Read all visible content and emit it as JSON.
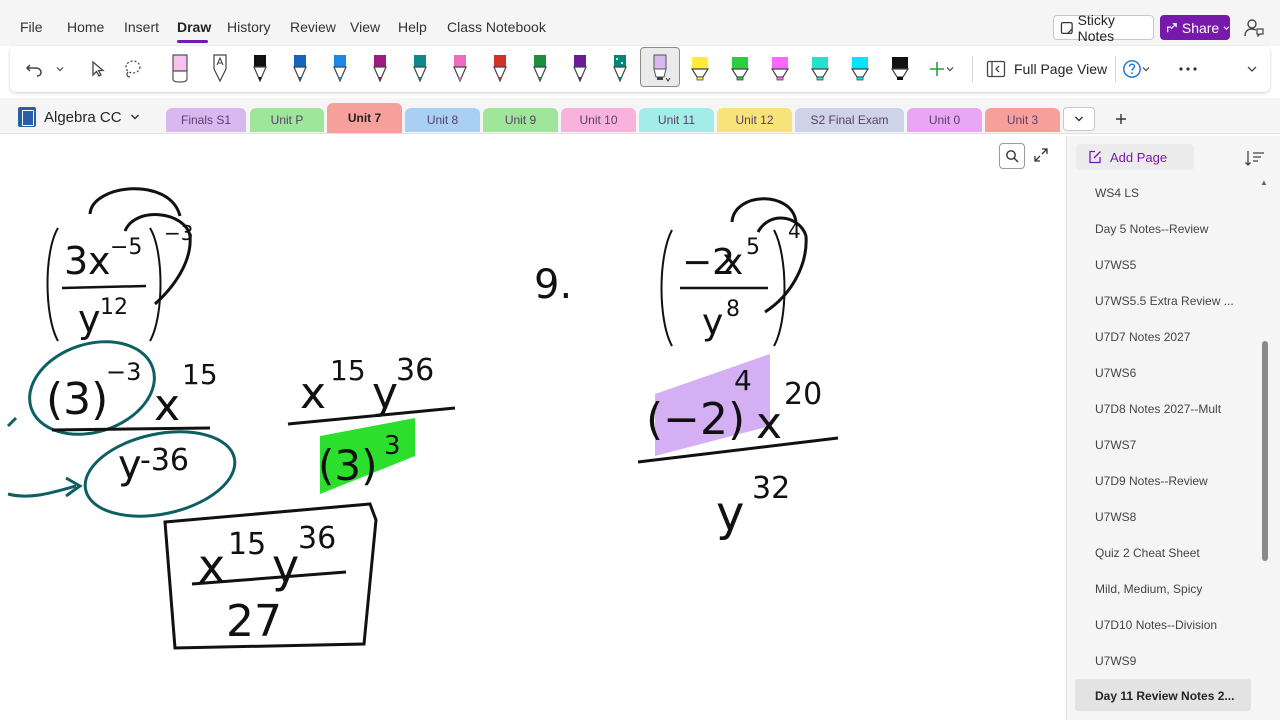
{
  "menu": {
    "items": [
      "File",
      "Home",
      "Insert",
      "Draw",
      "History",
      "Review",
      "View",
      "Help",
      "Class Notebook"
    ],
    "active": "Draw",
    "sticky_notes": "Sticky Notes",
    "share": "Share"
  },
  "ribbon": {
    "full_page_view": "Full Page View",
    "pen_colors": [
      "#ffffff",
      "#ffffff",
      "#111111",
      "#1565c0",
      "#1e88e5",
      "#a01880",
      "#0f8a8a",
      "#f06bbf",
      "#d32f2f",
      "#1e8e3e",
      "#6a1b9a",
      "#00897b",
      "#bdbdbd",
      "#ffeb3b",
      "#2ecc40",
      "#ff66ff",
      "#26e0c9",
      "#00e5ff",
      "#111111"
    ]
  },
  "notebook": {
    "name": "Algebra CC"
  },
  "sections": [
    {
      "label": "Finals S1",
      "color": "#d9b8f0"
    },
    {
      "label": "Unit P",
      "color": "#9fe59a"
    },
    {
      "label": "Unit 7",
      "color": "#f7a09b"
    },
    {
      "label": "Unit 8",
      "color": "#a9cff3"
    },
    {
      "label": "Unit 9",
      "color": "#9fe59a"
    },
    {
      "label": "Unit 10",
      "color": "#f7b3dc"
    },
    {
      "label": "Unit 11",
      "color": "#a3ece8"
    },
    {
      "label": "Unit 12",
      "color": "#f8e27a"
    },
    {
      "label": "S2 Final Exam",
      "color": "#cfd3e8"
    },
    {
      "label": "Unit 0",
      "color": "#e9a6f4"
    },
    {
      "label": "Unit 3",
      "color": "#f7a09b"
    }
  ],
  "active_section": "Unit 7",
  "page_panel": {
    "add_page": "Add Page",
    "pages": [
      "WS4 LS",
      "Day 5 Notes--Review",
      "U7WS5",
      "U7WS5.5 Extra Review ...",
      "U7D7 Notes 2027",
      "U7WS6",
      "U7D8 Notes 2027--Mult",
      "U7WS7",
      "U7D9 Notes--Review",
      "U7WS8",
      "Quiz 2 Cheat Sheet",
      "Mild, Medium, Spicy",
      "U7D10 Notes--Division",
      "U7WS9",
      "Day 11 Review Notes 2..."
    ],
    "selected": "Day 11 Review Notes 2..."
  },
  "ink": {
    "problem_number": "9.",
    "left_problem": {
      "coef": "3",
      "var": "x",
      "x_exp": "−5",
      "den_var": "y",
      "den_exp": "12",
      "outer_exp": "−3"
    },
    "left_step1": {
      "num_base": "(3)",
      "num_base_exp": "−3",
      "num_var": "x",
      "num_var_exp": "15",
      "den_var": "y",
      "den_exp": "-36"
    },
    "left_step2": {
      "num": "x",
      "num_x_exp": "15",
      "num_y": "y",
      "num_y_exp": "36",
      "den_base": "(3)",
      "den_exp": "3"
    },
    "left_answer": {
      "num": "x",
      "num_x_exp": "15",
      "num_y": "y",
      "num_y_exp": "36",
      "den": "27"
    },
    "right_problem": {
      "coef": "−2",
      "var": "x",
      "x_exp": "5",
      "den_var": "y",
      "den_exp": "8",
      "outer_exp": "4"
    },
    "right_step1": {
      "num_base": "(−2)",
      "num_base_exp": "4",
      "num_var": "x",
      "num_var_exp": "20",
      "den_var": "y",
      "den_exp": "32"
    },
    "highlight_colors": {
      "green": "#22dd22",
      "purple": "#c99bf0",
      "teal_ink": "#0d5f62"
    }
  }
}
